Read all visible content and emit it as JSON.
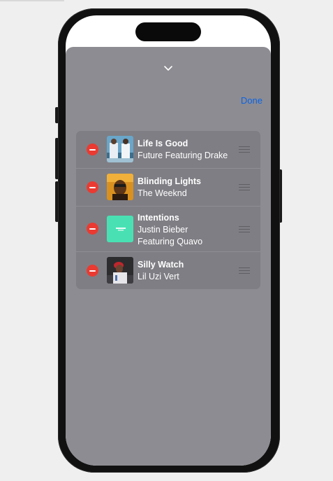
{
  "sheet": {
    "grabber_icon": "chevron-down-icon",
    "done_label": "Done"
  },
  "songs": [
    {
      "title": "Life Is Good",
      "artist": "Future Featuring Drake"
    },
    {
      "title": "Blinding Lights",
      "artist": "The Weeknd"
    },
    {
      "title": "Intentions",
      "artist": "Justin Bieber Featuring Quavo"
    },
    {
      "title": "Silly Watch",
      "artist": "Lil Uzi Vert"
    }
  ],
  "icons": {
    "remove": "minus-circle-icon",
    "reorder": "reorder-handle-icon"
  },
  "colors": {
    "accent": "#0a63e3",
    "sheet_background": "#8d8c92",
    "list_background": "#7f7e84",
    "remove_red": "#ea3a31"
  }
}
